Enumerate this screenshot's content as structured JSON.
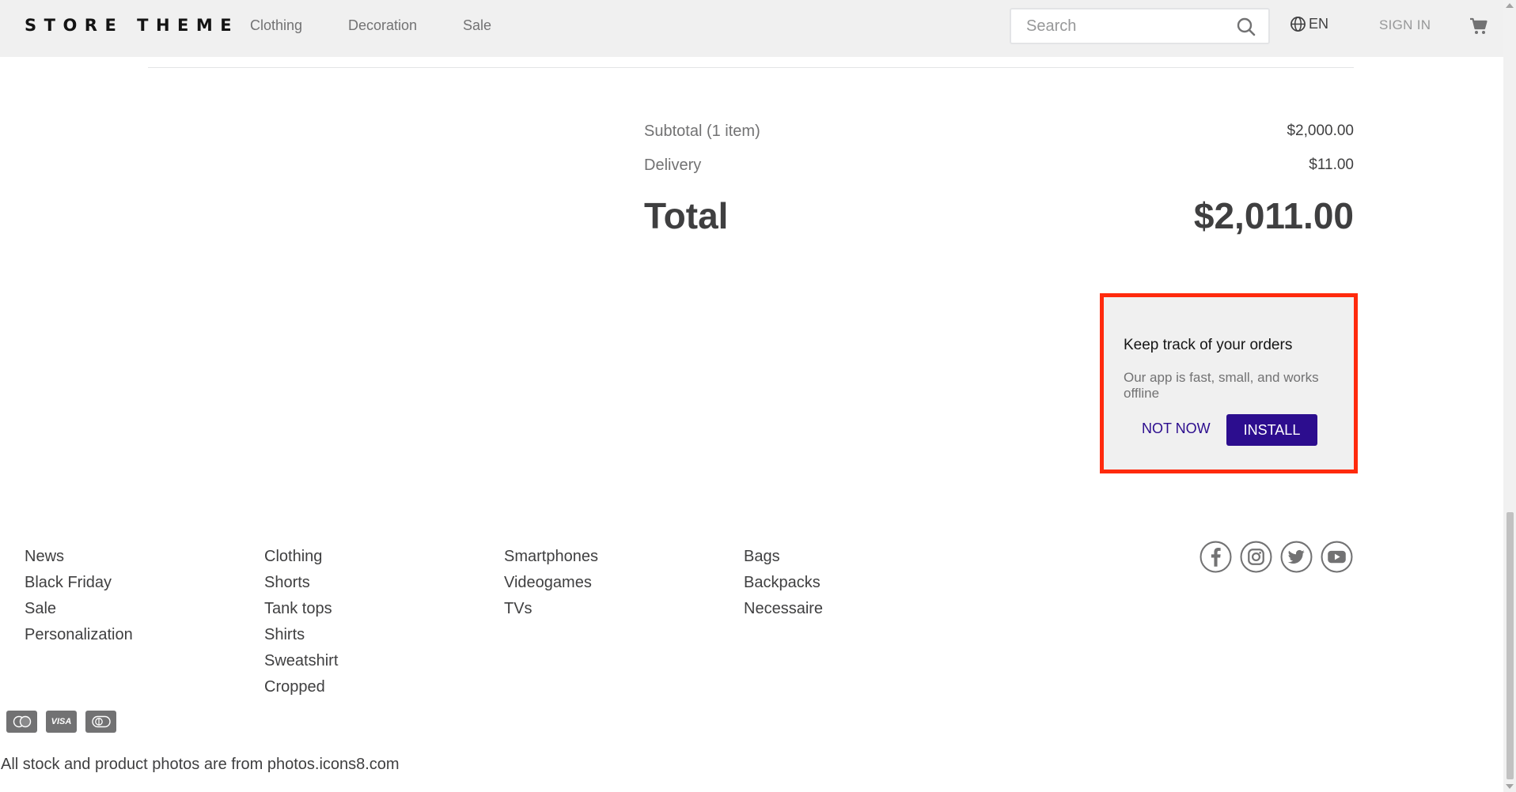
{
  "header": {
    "logo": "STORE THEME",
    "nav": [
      "Clothing",
      "Decoration",
      "Sale"
    ],
    "search_placeholder": "Search",
    "language": "EN",
    "sign_in": "SIGN IN"
  },
  "summary": {
    "subtotal_label": "Subtotal (1 item)",
    "subtotal_value": "$2,000.00",
    "delivery_label": "Delivery",
    "delivery_value": "$11.00",
    "total_label": "Total",
    "total_value": "$2,011.00"
  },
  "install_prompt": {
    "title": "Keep track of your orders",
    "text": "Our app is fast, small, and works offline",
    "not_now": "NOT NOW",
    "install": "INSTALL"
  },
  "footer": {
    "col1": [
      "News",
      "Black Friday",
      "Sale",
      "Personalization"
    ],
    "col2": [
      "Clothing",
      "Shorts",
      "Tank tops",
      "Shirts",
      "Sweatshirt",
      "Cropped"
    ],
    "col3": [
      "Smartphones",
      "Videogames",
      "TVs"
    ],
    "col4": [
      "Bags",
      "Backpacks",
      "Necessaire"
    ],
    "social_icons": [
      "facebook-icon",
      "instagram-icon",
      "twitter-icon",
      "youtube-icon"
    ],
    "payment_icons": [
      "mastercard-icon",
      "visa-icon",
      "diners-icon"
    ],
    "visa_text": "VISA",
    "credits": "All stock and product photos are from photos.icons8.com"
  },
  "colors": {
    "accent": "#2c0d8e",
    "highlight_border": "#ff2a0d",
    "header_bg": "#f0f0f0"
  }
}
